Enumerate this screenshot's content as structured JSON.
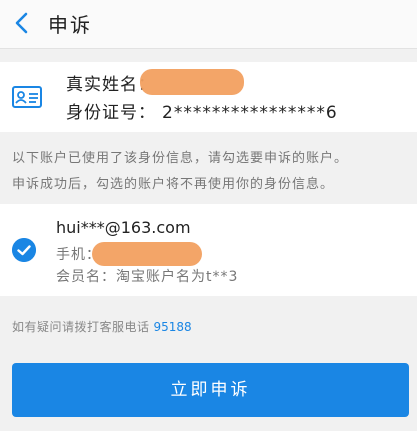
{
  "header": {
    "back_icon": "chevron-left-icon",
    "title": "申诉"
  },
  "identity": {
    "icon": "id-card-icon",
    "name_label": "真实姓名：",
    "id_label": "身份证号：",
    "id_value": "2****************6"
  },
  "notice": {
    "line1": "以下账户已使用了该身份信息，请勾选要申诉的账户。",
    "line2": "申诉成功后，勾选的账户将不再使用你的身份信息。"
  },
  "account": {
    "checked_icon": "checkmark-circle-icon",
    "email": "hui***@163.com",
    "phone_label": "手机：",
    "member_label": "会员名：",
    "member_value": "淘宝账户名为t**3"
  },
  "hotline": {
    "text": "如有疑问请拨打客服电话",
    "number": "95188"
  },
  "submit_label": "立即申诉",
  "colors": {
    "accent": "#1a86e4",
    "redaction": "#f2a060"
  }
}
